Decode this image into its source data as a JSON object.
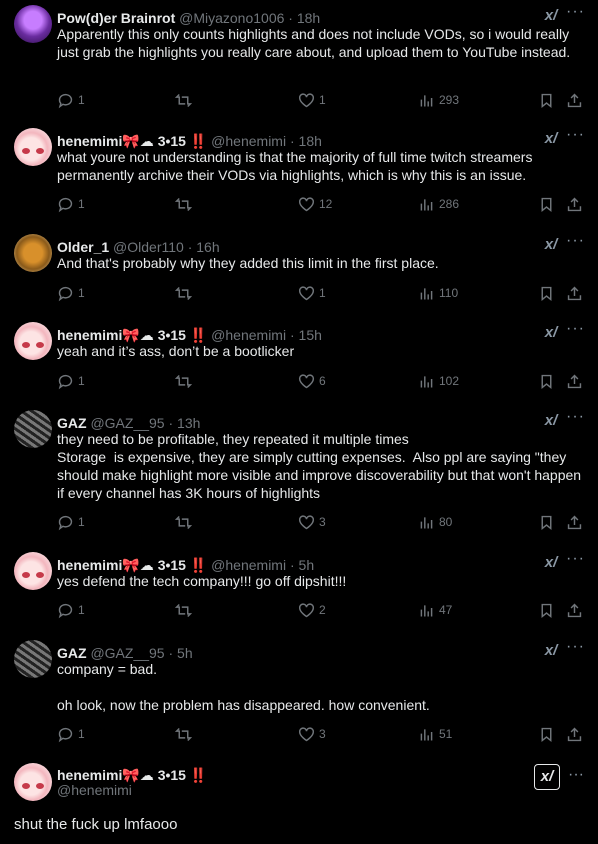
{
  "tweets": [
    {
      "name": "Pow(d)er Brainrot",
      "handle": "@Miyazono1006",
      "time": "18h",
      "text": "Apparently this only counts highlights and does not include VODs, so i would really just grab the highlights you really care about, and upload them to YouTube instead.",
      "replies": "1",
      "retweets": "",
      "likes": "1",
      "views": "293",
      "avatar": "purple-avatar"
    },
    {
      "name": "henemimi",
      "deco": "3•15",
      "handle": "@henemimi",
      "time": "18h",
      "text": "what youre not understanding is that the majority of full time twitch streamers permanently archive their VODs via highlights, which is why this is an issue.",
      "replies": "1",
      "retweets": "",
      "likes": "12",
      "views": "286",
      "avatar": "anime-avatar"
    },
    {
      "name": "Older_1",
      "handle": "@Older110",
      "time": "16h",
      "text": "And that's probably why they added this limit in the first place.",
      "replies": "1",
      "retweets": "",
      "likes": "1",
      "views": "110",
      "avatar": "older-avatar"
    },
    {
      "name": "henemimi",
      "deco": "3•15",
      "handle": "@henemimi",
      "time": "15h",
      "text": "yeah and it’s ass, don’t be a bootlicker",
      "replies": "1",
      "retweets": "",
      "likes": "6",
      "views": "102",
      "avatar": "anime-avatar"
    },
    {
      "name": "GAZ",
      "handle": "@GAZ__95",
      "time": "13h",
      "text": "they need to be profitable, they repeated it multiple times\nStorage  is expensive, they are simply cutting expenses.  Also ppl are saying \"they should make highlight more visible and improve discoverability but that won't happen if every channel has 3K hours of highlights",
      "replies": "1",
      "retweets": "",
      "likes": "3",
      "views": "80",
      "avatar": "gaz-avatar"
    },
    {
      "name": "henemimi",
      "deco": "3•15",
      "handle": "@henemimi",
      "time": "5h",
      "text": "yes defend the tech company!!! go off dipshit!!!",
      "replies": "1",
      "retweets": "",
      "likes": "2",
      "views": "47",
      "avatar": "anime-avatar"
    },
    {
      "name": "GAZ",
      "handle": "@GAZ__95",
      "time": "5h",
      "text": "company = bad.\n\noh look, now the problem has disappeared. how convenient.",
      "replies": "1",
      "retweets": "",
      "likes": "3",
      "views": "51",
      "avatar": "gaz-avatar"
    }
  ],
  "main": {
    "name": "henemimi",
    "deco": "3•15",
    "handle": "@henemimi",
    "text": "shut the fuck up lmfaooo"
  },
  "ui": {
    "dot": "·",
    "bang": "‼️",
    "bow": "🎀",
    "cloud": "☁",
    "more": "···",
    "grok": "x/"
  },
  "colors": {
    "background": "#000000",
    "text": "#e7e9ea",
    "muted": "#71767b",
    "accent": "#e0245e"
  }
}
